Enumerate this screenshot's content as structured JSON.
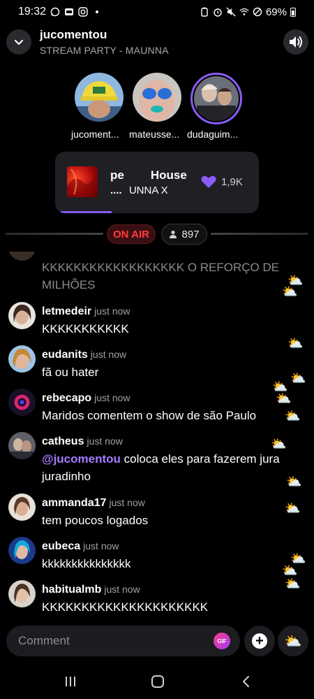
{
  "status_bar": {
    "time": "19:32",
    "battery": "69%",
    "left_icons": [
      "whatsapp-icon",
      "sim-icon",
      "instagram-icon",
      "dot-icon"
    ],
    "right_icons": [
      "battery-saver-icon",
      "alarm-icon",
      "mute-icon",
      "wifi-icon",
      "dnd-icon",
      "battery-icon"
    ]
  },
  "header": {
    "title": "jucomentou",
    "subtitle": "STREAM PARTY - MAUNNA"
  },
  "hosts": [
    {
      "name": "jucoment..."
    },
    {
      "name": "mateusse..."
    },
    {
      "name": "dudaguim..."
    }
  ],
  "now_playing": {
    "title_part1": "pe",
    "title_part2": "House",
    "artist_prefix": "....",
    "artist": "UNNA X",
    "likes": "1,9K",
    "progress": 0.25
  },
  "live": {
    "on_air_label": "ON AIR",
    "viewers": "897"
  },
  "chat": [
    {
      "user": "",
      "time": "",
      "text": "KKKKKKKKKKKKKKKKKK O REFORÇO DE MILHÕES"
    },
    {
      "user": "letmedeir",
      "time": "just now",
      "text": "KKKKKKKKKKK"
    },
    {
      "user": "eudanits",
      "time": "just now",
      "text": "fã ou hater"
    },
    {
      "user": "rebecapo",
      "time": "just now",
      "text": "Maridos comentem o show de são Paulo"
    },
    {
      "user": "catheus",
      "time": "just now",
      "mention": "@jucomentou",
      "text": "coloca eles para fazerem jura juradinho"
    },
    {
      "user": "ammanda17",
      "time": "just now",
      "text": "tem poucos logados"
    },
    {
      "user": "eubeca",
      "time": "just now",
      "text": "kkkkkkkkkkkkkkk"
    },
    {
      "user": "habitualmb",
      "time": "just now",
      "text": "KKKKKKKKKKKKKKKKKKKKK"
    }
  ],
  "composer": {
    "placeholder": "Comment",
    "gif_label": "GIF"
  },
  "colors": {
    "accent": "#8a5cf6",
    "on_air": "#ff3b3b",
    "mention": "#a37bff",
    "background": "#000000"
  }
}
